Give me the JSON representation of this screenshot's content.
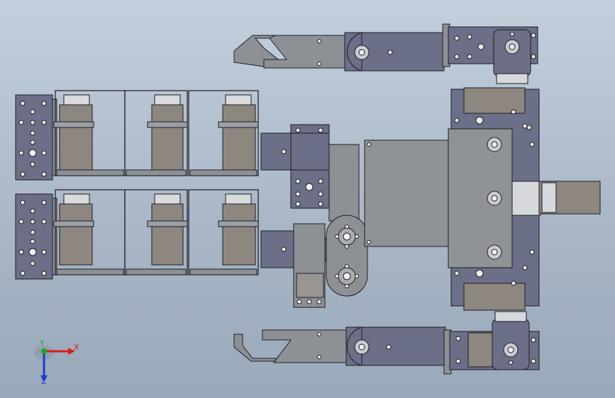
{
  "scene": {
    "name": "robot-assembly-top-view",
    "background_top": "#c3cfdc",
    "background_bottom": "#9aa9ba",
    "part_colors": {
      "servo_body": "#8e8780",
      "bracket_blue": "#6b6f88",
      "bracket_gray": "#8d9196",
      "plate": "#8f9396",
      "outline": "#1d1d22",
      "hole": "#f2f2f2"
    }
  },
  "triad": {
    "x_label": "X",
    "y_label": "Y",
    "z_label": "Z",
    "x_color": "#d11f1f",
    "y_color": "#19a81c",
    "z_color": "#1f3bd1"
  }
}
